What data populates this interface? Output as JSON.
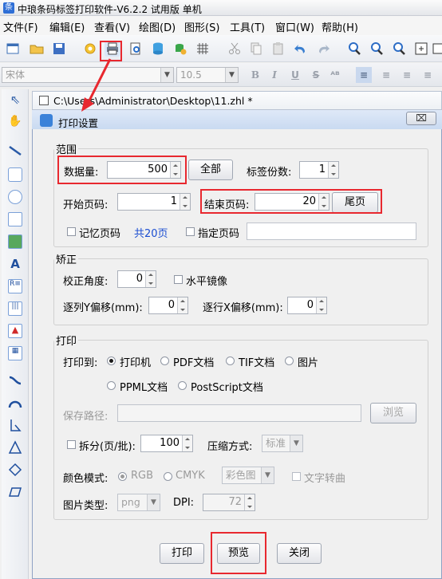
{
  "app": {
    "title": "中琅条码标签打印软件-V6.2.2 试用版 单机"
  },
  "menu": [
    "文件(F)",
    "编辑(E)",
    "查看(V)",
    "绘图(D)",
    "图形(S)",
    "工具(T)",
    "窗口(W)",
    "帮助(H)"
  ],
  "format_bar": {
    "font": "宋体",
    "size": "10.5",
    "bold": "B",
    "italic": "I",
    "underline": "U",
    "strike": "S"
  },
  "document": {
    "path": "C:\\Users\\Administrator\\Desktop\\11.zhl *"
  },
  "dialog": {
    "title": "打印设置",
    "close_label": "⌧",
    "range": {
      "legend": "范围",
      "data_count_label": "数据量:",
      "data_count_value": "500",
      "all_button": "全部",
      "copies_label": "标签份数:",
      "copies_value": "1",
      "start_page_label": "开始页码:",
      "start_page_value": "1",
      "end_page_label": "结束页码:",
      "end_page_value": "20",
      "last_page_button": "尾页",
      "remember_page_label": "记忆页码",
      "total_pages": "共20页",
      "specify_page_label": "指定页码"
    },
    "correction": {
      "legend": "矫正",
      "angle_label": "校正角度:",
      "angle_value": "0",
      "mirror_label": "水平镜像",
      "col_y_offset_label": "逐列Y偏移(mm):",
      "col_y_offset_value": "0",
      "row_x_offset_label": "逐行X偏移(mm):",
      "row_x_offset_value": "0"
    },
    "print": {
      "legend": "打印",
      "print_to_label": "打印到:",
      "targets": [
        "打印机",
        "PDF文档",
        "TIF文档",
        "图片",
        "PPML文档",
        "PostScript文档"
      ],
      "selected_target": "打印机",
      "save_path_label": "保存路径:",
      "browse_button": "浏览",
      "split_label": "拆分(页/批):",
      "split_value": "100",
      "compression_label": "压缩方式:",
      "compression_value": "标准",
      "color_mode_label": "颜色模式:",
      "color_modes": [
        "RGB",
        "CMYK"
      ],
      "color_profile_value": "彩色图",
      "text_curve_label": "文字转曲",
      "image_type_label": "图片类型:",
      "image_type_value": "png",
      "dpi_label": "DPI:",
      "dpi_value": "72"
    },
    "buttons": {
      "print": "打印",
      "preview": "预览",
      "close": "关闭"
    }
  },
  "colors": {
    "highlight": "#e8282f",
    "accent": "#1a4dd1"
  }
}
